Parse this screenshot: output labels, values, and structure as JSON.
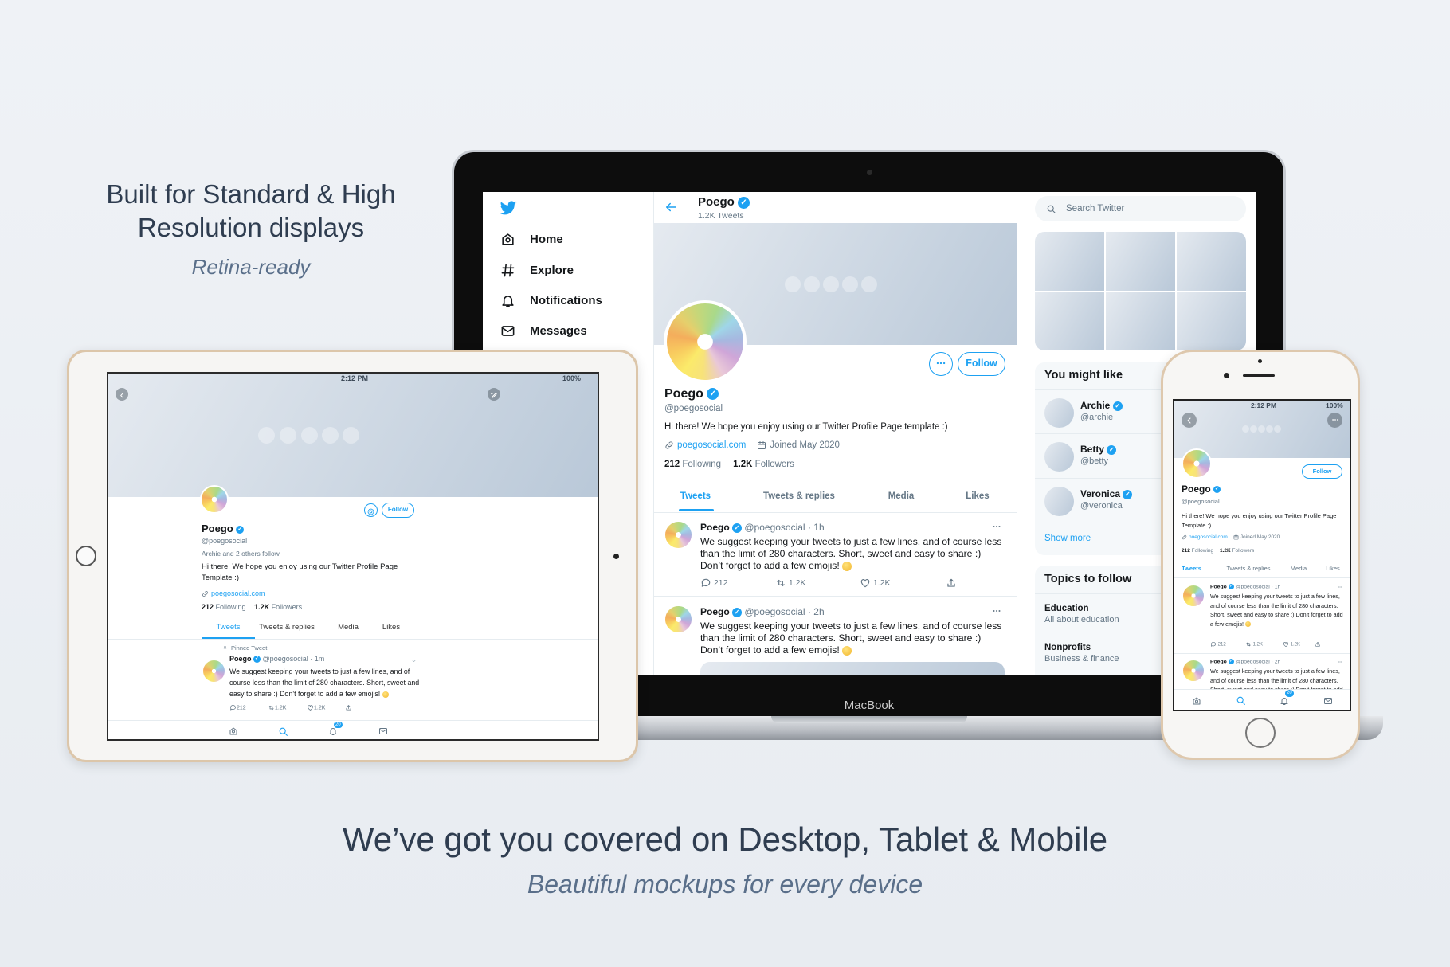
{
  "marketing": {
    "headline_left_line1": "Built for Standard & High",
    "headline_left_line2": "Resolution displays",
    "tagline_left": "Retina-ready",
    "headline_bottom": "We’ve got you covered on Desktop, Tablet & Mobile",
    "tagline_bottom": "Beautiful mockups for every device"
  },
  "laptop_label": "MacBook",
  "colors": {
    "accent": "#1da1f2",
    "text": "#14171a",
    "muted": "#657786",
    "background": "#eef2f6",
    "tablet_frame": "#dcc6aa"
  },
  "nav": [
    {
      "label": "Home",
      "icon": "home-icon"
    },
    {
      "label": "Explore",
      "icon": "hash-icon"
    },
    {
      "label": "Notifications",
      "icon": "bell-icon"
    },
    {
      "label": "Messages",
      "icon": "mail-icon"
    }
  ],
  "profile": {
    "name": "Poego",
    "handle": "@poegosocial",
    "tweets_count": "1.2K Tweets",
    "bio": "Hi there! We hope you enjoy using our Twitter Profile Page template :)",
    "bio_alt": "Hi there! We hope you enjoy using our Twitter Profile Page Template :)",
    "website": "poegosocial.com",
    "joined": "Joined May 2020",
    "following_count": "212",
    "following_label": "Following",
    "followers_count": "1.2K",
    "followers_label": "Followers",
    "follow_label": "Follow",
    "followed_by": "Archie and 2 others follow"
  },
  "tabs": [
    "Tweets",
    "Tweets & replies",
    "Media",
    "Likes"
  ],
  "separator": "·",
  "tweets": [
    {
      "name": "Poego",
      "handle": "@poegosocial",
      "time": "1h",
      "text": "We suggest keeping your tweets to just a few lines, and of course less than the limit of 280 characters. Short, sweet and easy to share :) Don’t forget to add a few emojis!",
      "replies": "212",
      "retweets": "1.2K",
      "likes": "1.2K"
    },
    {
      "name": "Poego",
      "handle": "@poegosocial",
      "time": "2h",
      "text": "We suggest keeping your tweets to just a few lines, and of course less than the limit of 280 characters. Short, sweet and easy to share :) Don’t forget to add a few emojis!"
    }
  ],
  "tablet_tweet": {
    "pinned_label": "Pinned Tweet",
    "name": "Poego",
    "handle": "@poegosocial",
    "time": "1m",
    "text": "We suggest keeping your tweets to just a few lines, and of course less than the limit of 280 characters. Short, sweet and easy to share :) Don’t forget to add a few emojis!",
    "replies": "212",
    "retweets": "1.2K",
    "likes": "1.2K"
  },
  "search": {
    "placeholder": "Search Twitter"
  },
  "who_to_follow": {
    "title": "You might like",
    "users": [
      {
        "name": "Archie",
        "handle": "@archie"
      },
      {
        "name": "Betty",
        "handle": "@betty"
      },
      {
        "name": "Veronica",
        "handle": "@veronica"
      }
    ],
    "show_more": "Show more"
  },
  "topics": {
    "title": "Topics to follow",
    "items": [
      {
        "name": "Education",
        "sub": "All about education"
      },
      {
        "name": "Nonprofits",
        "sub": "Business & finance"
      }
    ]
  },
  "status_bar": {
    "time": "2:12 PM",
    "battery": "100%"
  },
  "notifications_badge": "20"
}
